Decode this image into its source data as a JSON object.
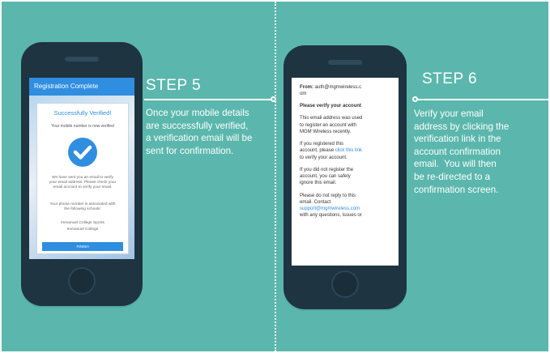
{
  "step5": {
    "label": "STEP 5",
    "desc": [
      "Once your mobile details",
      "are successfully verified,",
      "a verification email will be",
      "sent for confirmation."
    ]
  },
  "step6": {
    "label": "STEP 6",
    "desc": [
      "Verify your email",
      "address by clicking the",
      "verification link in the",
      "account confirmation",
      "email.  You will then",
      "be re-directed to a",
      "confirmation screen."
    ]
  },
  "phone1": {
    "appbar_title": "Registration Complete",
    "card_title": "Successfully Verified!",
    "card_subtitle": "Your mobile number is now verified",
    "email_notice": [
      "We have sent you an email to verify",
      "your email address. Please check your",
      "email account to verify your email."
    ],
    "schools_intro": [
      "Your phone number is associated with",
      "the following schools:"
    ],
    "schools": [
      "Immanuel College Sports",
      "Immanuel College"
    ],
    "finish_label": "FINISH"
  },
  "phone2": {
    "from_label": "From:",
    "from_lines": [
      "auth@mgmwireless.c",
      "om"
    ],
    "subject": "Please verify your account",
    "p1": [
      "This email address was used",
      "to register an account with",
      "MGM Wireless recently."
    ],
    "p2_pre": [
      "If you registered this",
      "account, please "
    ],
    "p2_link": "click this link",
    "p2_post": "to verify your account.",
    "p3": [
      "If you did not register the",
      "account, you can safely",
      "ignore this email."
    ],
    "p4_pre": [
      "Please do not reply to this",
      "email. Contact"
    ],
    "p4_link": "support@mgmwireless.com",
    "p4_post": [
      "with any questions, issues or"
    ]
  }
}
